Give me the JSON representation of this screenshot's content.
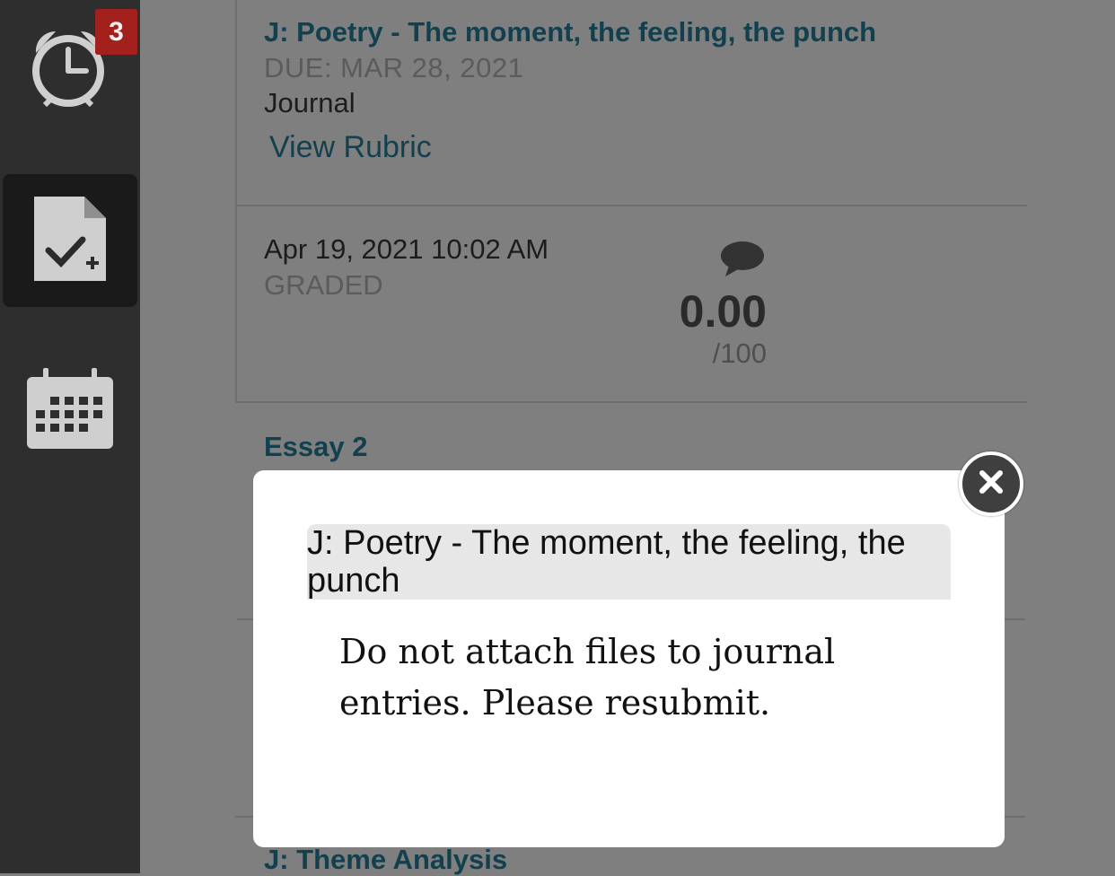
{
  "sidebar": {
    "alerts_badge": "3",
    "items": [
      {
        "icon": "alarm-clock-icon"
      },
      {
        "icon": "assignment-check-icon"
      },
      {
        "icon": "calendar-icon"
      }
    ]
  },
  "assignments": [
    {
      "title": "J: Poetry - The moment, the feeling, the punch",
      "due": "DUE: MAR 28, 2021",
      "type": "Journal",
      "rubric_link": "View Rubric",
      "submission": {
        "date": "Apr 19, 2021 10:02 AM",
        "status": "GRADED",
        "score": "0.00",
        "out_of": "/100"
      }
    },
    {
      "title": "Essay 2"
    },
    {
      "title": "J: Theme Analysis"
    }
  ],
  "modal": {
    "title": "J: Poetry - The moment, the feeling, the punch",
    "message": "Do not attach files to journal entries. Please resubmit."
  },
  "colors": {
    "link": "#13404e",
    "badge": "#a3211d",
    "sidebar": "#2e2e2e"
  }
}
